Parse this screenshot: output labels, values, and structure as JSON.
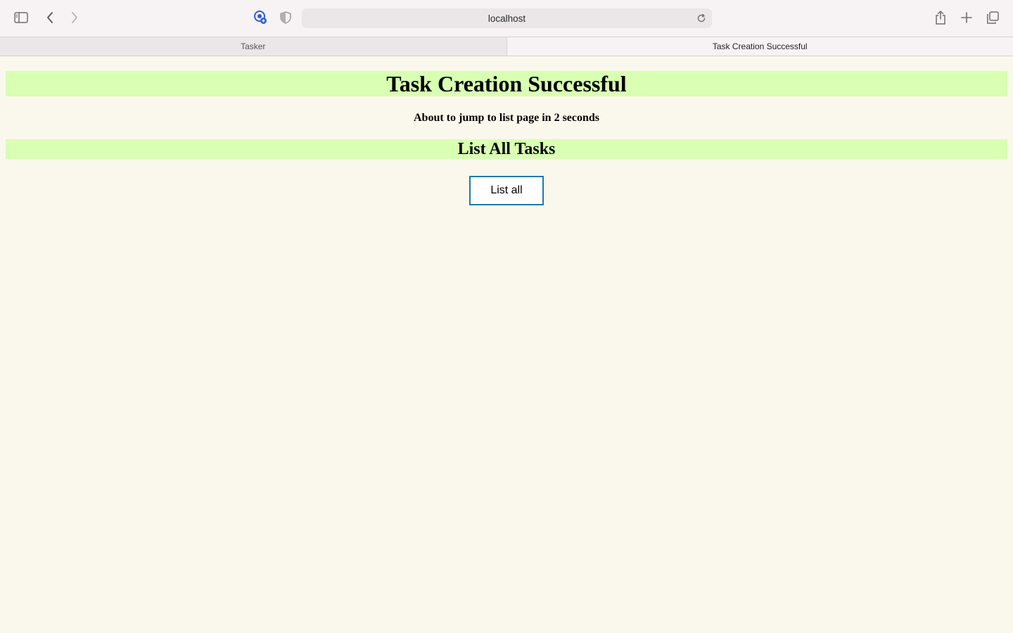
{
  "browser": {
    "address": "localhost",
    "tabs": [
      {
        "label": "Tasker",
        "active": false
      },
      {
        "label": "Task Creation Successful",
        "active": true
      }
    ],
    "icons": {
      "sidebar": "sidebar-toggle-icon",
      "back": "chevron-left-icon",
      "forward": "chevron-right-icon",
      "extension": "extension-badge-icon",
      "privacy": "shield-icon",
      "reload": "reload-icon",
      "share": "share-icon",
      "new_tab": "plus-icon",
      "tab_overview": "tab-overview-icon"
    },
    "accent_color": "#2f5bd8"
  },
  "page": {
    "title": "Task Creation Successful",
    "redirect_message": "About to jump to list page in 2 seconds",
    "section_title": "List All Tasks",
    "list_button_label": "List all",
    "banner_color": "#d8ffb2",
    "background_color": "#faf8ec",
    "button_border_color": "#1e7ba8"
  }
}
